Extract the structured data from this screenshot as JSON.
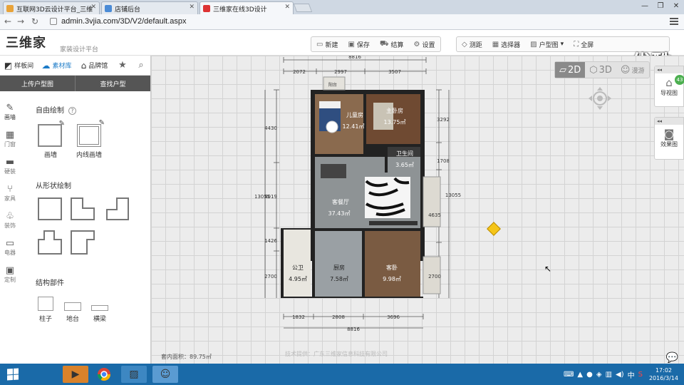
{
  "browser": {
    "tabs": [
      {
        "title": "互联网3D云设计平台_三维"
      },
      {
        "title": "店铺后台"
      },
      {
        "title": "三维家在线3D设计"
      }
    ],
    "url": "admin.3vjia.com/3D/V2/default.aspx",
    "window_controls": [
      "—",
      "❐",
      "✕"
    ]
  },
  "watermark": "优酷",
  "app": {
    "logo": "三维家",
    "logo_sub": "家装设计平台",
    "toolbar_left": [
      {
        "label": "新建",
        "icon": "new-doc-icon"
      },
      {
        "label": "保存",
        "icon": "save-icon"
      },
      {
        "label": "结算",
        "icon": "cart-icon"
      },
      {
        "label": "设置",
        "icon": "gear-icon"
      }
    ],
    "toolbar_right": [
      {
        "label": "测距",
        "icon": "ruler-icon"
      },
      {
        "label": "选择器",
        "icon": "grid-icon"
      },
      {
        "label": "户型图",
        "icon": "image-icon"
      },
      {
        "label": "全屏",
        "icon": "fullscreen-icon"
      },
      {
        "label": "帮助",
        "icon": "help-icon"
      },
      {
        "label": "更多...",
        "icon": "more-icon"
      }
    ]
  },
  "left_panel": {
    "tabs": [
      {
        "label": "样板间",
        "icon": "cube-icon",
        "active": false
      },
      {
        "label": "素材库",
        "icon": "cloud-icon",
        "active": true
      },
      {
        "label": "品牌馆",
        "icon": "tag-icon",
        "active": false
      }
    ],
    "subtabs": [
      "上传户型图",
      "查找户型"
    ],
    "categories": [
      {
        "label": "画墙",
        "icon": "pencil-icon"
      },
      {
        "label": "门窗",
        "icon": "window-icon"
      },
      {
        "label": "硬装",
        "icon": "roller-icon"
      },
      {
        "label": "家具",
        "icon": "chair-icon"
      },
      {
        "label": "装饰",
        "icon": "plant-icon"
      },
      {
        "label": "电器",
        "icon": "monitor-icon"
      },
      {
        "label": "定制",
        "icon": "blocks-icon"
      }
    ],
    "section_free": "自由绘制",
    "free_tools": [
      "画墙",
      "内线画墙"
    ],
    "section_shape": "从形状绘制",
    "section_struct": "结构部件",
    "struct_tools": [
      "柱子",
      "地台",
      "横梁"
    ]
  },
  "canvas": {
    "view_modes": [
      {
        "label": "2D",
        "active": true
      },
      {
        "label": "3D",
        "active": false
      },
      {
        "label": "漫游",
        "active": false
      }
    ],
    "right_panels": [
      {
        "label": "导视图",
        "badge": "43"
      },
      {
        "label": "效果图"
      }
    ],
    "area_text": "套内面积：89.75㎡",
    "tech_text": "技术提供：广东三维家信息科技有限公司"
  },
  "floorplan": {
    "top_total": "8816",
    "top_segments": [
      "2072",
      "2997",
      "3507"
    ],
    "bottom_total": "8816",
    "bottom_segments": [
      "1832",
      "2808",
      "3696"
    ],
    "left_outer": "13055",
    "left_segments": [
      "4430",
      "4019",
      "1426",
      "2700"
    ],
    "right_outer": "13055",
    "right_segments": [
      "3292",
      "1708",
      "4635",
      "2700"
    ],
    "rooms": [
      {
        "name": "儿童房",
        "area": "12.41㎡"
      },
      {
        "name": "主卧房",
        "area": "13.75㎡"
      },
      {
        "name": "卫生间",
        "area": "3.65㎡"
      },
      {
        "name": "客餐厅",
        "area": "37.43㎡"
      },
      {
        "name": "公卫",
        "area": "4.95㎡"
      },
      {
        "name": "厨房",
        "area": "7.58㎡"
      },
      {
        "name": "客卧",
        "area": "9.98㎡"
      }
    ],
    "balcony_label": "阳台"
  },
  "taskbar": {
    "tray_lang": "中",
    "tray_s": "S",
    "time": "17:02",
    "date": "2016/3/14"
  }
}
